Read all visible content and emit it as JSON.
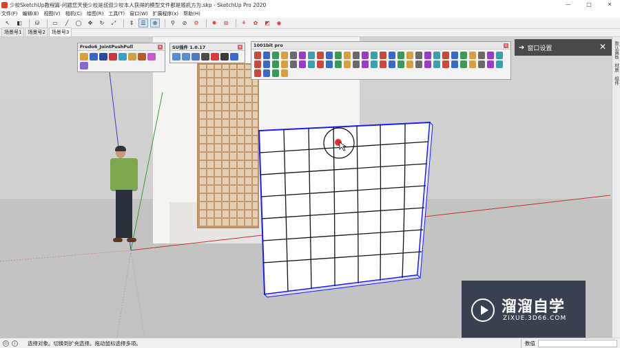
{
  "window": {
    "title": "少校SketchUp教程篇-问题您天使少校是叔叔少校本人获得的模型文件都是随机方为.skp - SketchUp Pro 2020",
    "controls": [
      "—",
      "□",
      "✕"
    ]
  },
  "menu": [
    "文件(F)",
    "编辑(E)",
    "视图(V)",
    "相机(C)",
    "绘图(R)",
    "工具(T)",
    "窗口(W)",
    "扩展程序(x)",
    "帮助(H)"
  ],
  "toolbar_icons": [
    "select-icon",
    "eraser-icon",
    "paint-icon",
    "rectangle-icon",
    "line-icon",
    "circle-icon",
    "move-icon",
    "rotate-icon",
    "scale-icon",
    "pushpull-icon",
    "orbit-icon",
    "pan-icon",
    "zoom-icon",
    "section-icon",
    "layers-icon",
    "camera-icon",
    "gear-icon",
    "render-icon",
    "warehouse-icon",
    "extension-icon"
  ],
  "scene_tabs": [
    "场景号1",
    "场景号2",
    "场景号3"
  ],
  "floating_toolbars": {
    "fredo": {
      "title": "Fredo6_JointPushPull",
      "icon_count": 9
    },
    "plugin": {
      "title": "SU插件 1.0.17",
      "icon_count": 7
    },
    "bit": {
      "title": "1001bit pro",
      "icon_count": 60
    }
  },
  "right_panel": {
    "title": "窗口设置"
  },
  "side_tabs": [
    "默认面板",
    "材质",
    "组件"
  ],
  "watermark": {
    "title": "溜溜自学",
    "subtitle": "ZIXUE.3D66.COM"
  },
  "status": {
    "message": "选择对象。切换到扩充选择。拖动鼠标选择多项。",
    "measure_label": "数值"
  },
  "colors": {
    "panel_dark": "#4a4a4a",
    "selection_blue": "#1a1aff",
    "axis_red": "#c83030",
    "axis_green": "#3a9a3a",
    "axis_blue": "#3a3ad0"
  }
}
